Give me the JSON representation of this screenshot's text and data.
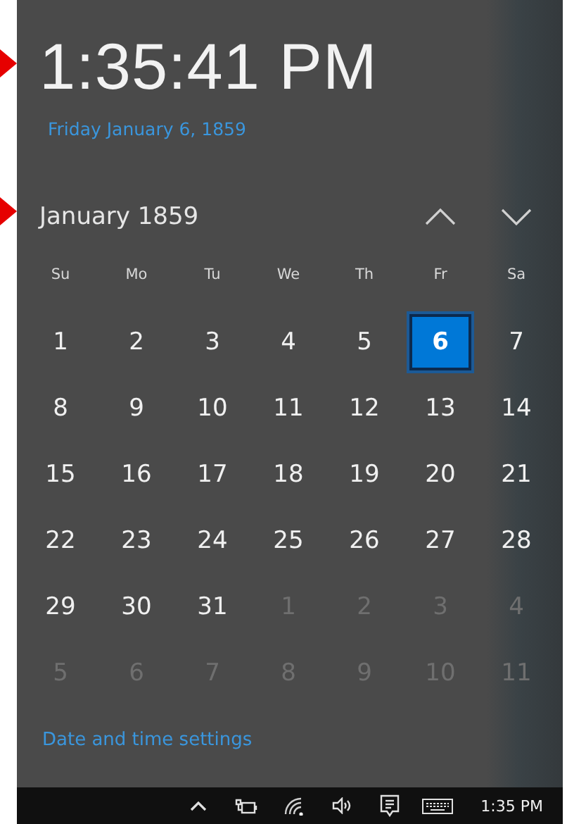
{
  "clock": {
    "time": "1:35:41 PM",
    "date": "Friday January 6, 1859"
  },
  "calendar": {
    "month": "January 1859",
    "weekdays": [
      "Su",
      "Mo",
      "Tu",
      "We",
      "Th",
      "Fr",
      "Sa"
    ],
    "days": [
      {
        "label": "1",
        "in_month": true,
        "selected": false
      },
      {
        "label": "2",
        "in_month": true,
        "selected": false
      },
      {
        "label": "3",
        "in_month": true,
        "selected": false
      },
      {
        "label": "4",
        "in_month": true,
        "selected": false
      },
      {
        "label": "5",
        "in_month": true,
        "selected": false
      },
      {
        "label": "6",
        "in_month": true,
        "selected": true
      },
      {
        "label": "7",
        "in_month": true,
        "selected": false
      },
      {
        "label": "8",
        "in_month": true,
        "selected": false
      },
      {
        "label": "9",
        "in_month": true,
        "selected": false
      },
      {
        "label": "10",
        "in_month": true,
        "selected": false
      },
      {
        "label": "11",
        "in_month": true,
        "selected": false
      },
      {
        "label": "12",
        "in_month": true,
        "selected": false
      },
      {
        "label": "13",
        "in_month": true,
        "selected": false
      },
      {
        "label": "14",
        "in_month": true,
        "selected": false
      },
      {
        "label": "15",
        "in_month": true,
        "selected": false
      },
      {
        "label": "16",
        "in_month": true,
        "selected": false
      },
      {
        "label": "17",
        "in_month": true,
        "selected": false
      },
      {
        "label": "18",
        "in_month": true,
        "selected": false
      },
      {
        "label": "19",
        "in_month": true,
        "selected": false
      },
      {
        "label": "20",
        "in_month": true,
        "selected": false
      },
      {
        "label": "21",
        "in_month": true,
        "selected": false
      },
      {
        "label": "22",
        "in_month": true,
        "selected": false
      },
      {
        "label": "23",
        "in_month": true,
        "selected": false
      },
      {
        "label": "24",
        "in_month": true,
        "selected": false
      },
      {
        "label": "25",
        "in_month": true,
        "selected": false
      },
      {
        "label": "26",
        "in_month": true,
        "selected": false
      },
      {
        "label": "27",
        "in_month": true,
        "selected": false
      },
      {
        "label": "28",
        "in_month": true,
        "selected": false
      },
      {
        "label": "29",
        "in_month": true,
        "selected": false
      },
      {
        "label": "30",
        "in_month": true,
        "selected": false
      },
      {
        "label": "31",
        "in_month": true,
        "selected": false
      },
      {
        "label": "1",
        "in_month": false,
        "selected": false
      },
      {
        "label": "2",
        "in_month": false,
        "selected": false
      },
      {
        "label": "3",
        "in_month": false,
        "selected": false
      },
      {
        "label": "4",
        "in_month": false,
        "selected": false
      },
      {
        "label": "5",
        "in_month": false,
        "selected": false
      },
      {
        "label": "6",
        "in_month": false,
        "selected": false
      },
      {
        "label": "7",
        "in_month": false,
        "selected": false
      },
      {
        "label": "8",
        "in_month": false,
        "selected": false
      },
      {
        "label": "9",
        "in_month": false,
        "selected": false
      },
      {
        "label": "10",
        "in_month": false,
        "selected": false
      },
      {
        "label": "11",
        "in_month": false,
        "selected": false
      }
    ]
  },
  "settings_link": "Date and time settings",
  "taskbar": {
    "time": "1:35 PM"
  }
}
